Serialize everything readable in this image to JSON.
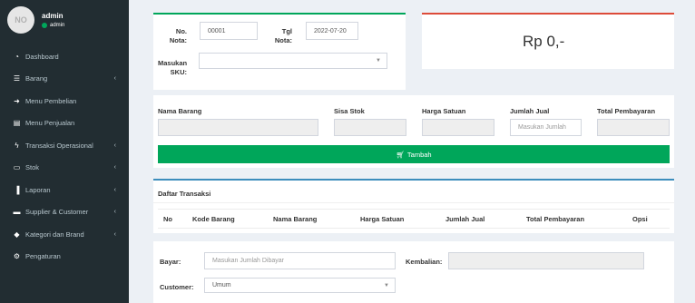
{
  "user": {
    "avatar_text": "NO",
    "name": "admin",
    "status": "admin"
  },
  "sidebar": {
    "items": [
      {
        "label": "Dashboard",
        "icon": "dashboard-icon",
        "glyph": "◔",
        "chevron": false
      },
      {
        "label": "Barang",
        "icon": "list-icon",
        "glyph": "☰",
        "chevron": true
      },
      {
        "label": "Menu Pembelian",
        "icon": "sign-in-icon",
        "glyph": "➜",
        "chevron": false
      },
      {
        "label": "Menu Penjualan",
        "icon": "cart-icon",
        "glyph": "▤",
        "chevron": false
      },
      {
        "label": "Transaksi Operasional",
        "icon": "bolt-icon",
        "glyph": "ϟ",
        "chevron": true
      },
      {
        "label": "Stok",
        "icon": "drive-icon",
        "glyph": "▭",
        "chevron": true
      },
      {
        "label": "Laporan",
        "icon": "bar-chart-icon",
        "glyph": "▐",
        "chevron": true
      },
      {
        "label": "Supplier & Customer",
        "icon": "id-card-icon",
        "glyph": "▬",
        "chevron": true
      },
      {
        "label": "Kategori dan Brand",
        "icon": "tag-icon",
        "glyph": "◆",
        "chevron": true
      },
      {
        "label": "Pengaturan",
        "icon": "gear-icon",
        "glyph": "⚙",
        "chevron": false
      }
    ],
    "chevron_glyph": "‹"
  },
  "form": {
    "no_nota_label_1": "No.",
    "no_nota_label_2": "Nota:",
    "no_nota_value": "00001",
    "tgl_label_1": "Tgl",
    "tgl_label_2": "Nota:",
    "tgl_value": "2022-07-20",
    "sku_label_1": "Masukan",
    "sku_label_2": "SKU:",
    "sku_value": ""
  },
  "total": {
    "amount": "Rp 0,-"
  },
  "item_entry": {
    "col_nama": "Nama Barang",
    "col_sisa": "Sisa Stok",
    "col_harga": "Harga Satuan",
    "col_jumlah": "Jumlah Jual",
    "col_total": "Total Pembayaran",
    "jumlah_placeholder": "Masukan Jumlah",
    "add_button": "Tambah"
  },
  "transactions": {
    "title": "Daftar Transaksi",
    "columns": [
      "No",
      "Kode Barang",
      "Nama Barang",
      "Harga Satuan",
      "Jumlah Jual",
      "Total Pembayaran",
      "Opsi"
    ],
    "rows": []
  },
  "payment": {
    "bayar_label": "Bayar:",
    "bayar_placeholder": "Masukan Jumlah Dibayar",
    "kembalian_label": "Kembalian:",
    "kembalian_value": "",
    "customer_label": "Customer:",
    "customer_value": "Umum"
  },
  "colors": {
    "sidebar": "#222d32",
    "accent_green": "#00a65a",
    "accent_red": "#dd4b39",
    "accent_blue": "#3c8dbc"
  }
}
